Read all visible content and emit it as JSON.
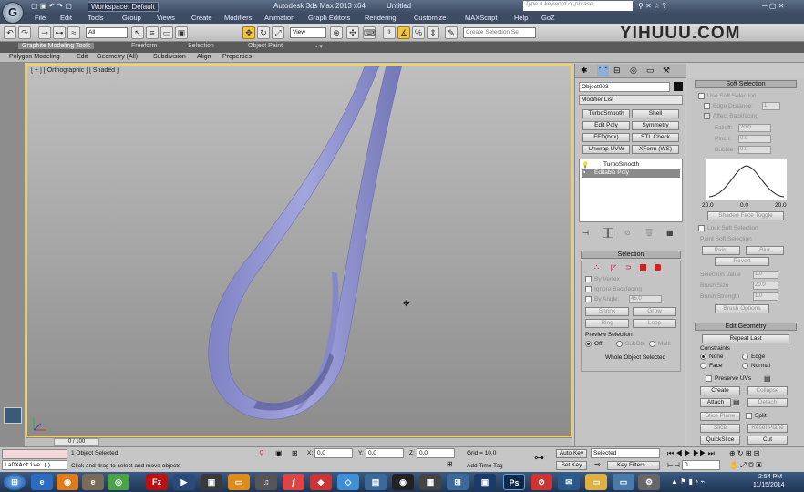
{
  "titlebar": {
    "workspace": "Workspace: Default",
    "title": "Autodesk 3ds Max 2013 x64",
    "doc": "Untitled",
    "search_placeholder": "Type a keyword or phrase"
  },
  "app_logo": "G",
  "menu": [
    "File",
    "Edit",
    "Tools",
    "Group",
    "Views",
    "Create",
    "Modifiers",
    "Animation",
    "Graph Editors",
    "Rendering",
    "Customize",
    "MAXScript",
    "Help",
    "GoZ"
  ],
  "toolbar": {
    "filter_value": "All",
    "refcoord_value": "View",
    "selection_set_placeholder": "Create Selection Se"
  },
  "watermark": "YIHUUU.COM",
  "ribbon": {
    "tabs": [
      "Graphite Modeling Tools",
      "Freeform",
      "Selection",
      "Object Paint"
    ],
    "subtabs": [
      "Polygon Modeling",
      "Edit",
      "Geometry (All)",
      "Subdivision",
      "Align",
      "Properties"
    ]
  },
  "viewport": {
    "label": "[ + ] [ Orthographic ] [ Shaded ]",
    "ribbon_color": "#9b9dd6"
  },
  "modify_panel": {
    "object_name": "Object003",
    "modifier_list": "Modifier List",
    "buttons": [
      "TurboSmooth",
      "Shell",
      "Edit Poly",
      "Symmetry",
      "FFD(box)",
      "STL Check",
      "Unwrap UVW",
      "XForm (WS)"
    ],
    "stack": [
      "TurboSmooth",
      "Editable Poly"
    ],
    "selection": {
      "header": "Selection",
      "by_vertex": "By Vertex",
      "ignore_backfacing": "Ignore Backfacing",
      "by_angle": "By Angle:",
      "angle_value": "45.0",
      "shrink": "Shrink",
      "grow": "Grow",
      "ring": "Ring",
      "loop": "Loop",
      "preview_header": "Preview Selection",
      "preview_off": "Off",
      "preview_subobj": "SubObj",
      "preview_multi": "Multi",
      "status": "Whole Object Selected"
    }
  },
  "soft_selection": {
    "header": "Soft Selection",
    "use_soft": "Use Soft Selection",
    "edge_distance": "Edge Distance:",
    "edge_distance_value": "1",
    "affect_backfacing": "Affect Backfacing",
    "falloff": "Falloff:",
    "falloff_value": "20.0",
    "pinch": "Pinch:",
    "pinch_value": "0.0",
    "bubble": "Bubble:",
    "bubble_value": "0.0",
    "curve_labels": [
      "20.0",
      "0.0",
      "20.0"
    ],
    "shaded_face_toggle": "Shaded Face Toggle",
    "lock_soft": "Lock Soft Selection",
    "paint_header": "Paint Soft Selection",
    "paint": "Paint",
    "blur": "Blur",
    "revert": "Revert",
    "selection_value": "Selection Value",
    "selection_value_num": "1.0",
    "brush_size": "Brush Size",
    "brush_size_num": "20.0",
    "brush_strength": "Brush Strength",
    "brush_strength_num": "1.0",
    "brush_options": "Brush Options"
  },
  "edit_geometry": {
    "header": "Edit Geometry",
    "repeat_last": "Repeat Last",
    "constraints": "Constraints",
    "none": "None",
    "edge": "Edge",
    "face": "Face",
    "normal": "Normal",
    "preserve_uvs": "Preserve UVs",
    "create": "Create",
    "collapse": "Collapse",
    "attach": "Attach",
    "detach": "Detach",
    "slice_plane": "Slice Plane",
    "split": "Split",
    "slice": "Slice",
    "reset_plane": "Reset Plane",
    "quickslice": "QuickSlice",
    "cut": "Cut"
  },
  "timeslider": "0 / 100",
  "status": {
    "selected": "1 Object Selected",
    "prompt": "Click and drag to select and move objects",
    "script_listener": "LaDXActive ()",
    "x_label": "X:",
    "x": "0.0",
    "y_label": "Y:",
    "y": "0.0",
    "z_label": "Z:",
    "z": "0.0",
    "grid": "Grid = 10.0",
    "add_time_tag": "Add Time Tag",
    "auto_key": "Auto Key",
    "set_key": "Set Key",
    "key_mode": "Selected",
    "key_filters": "Key Filters...",
    "frame": "0"
  },
  "taskbar": {
    "time": "2:54 PM",
    "date": "11/15/2014",
    "icons": [
      "start-orb",
      "ie",
      "firefox",
      "filezilla",
      "chrome",
      "media",
      "media-player",
      "photoshop-alt",
      "flash",
      "dropbox",
      "3dsmax",
      "network",
      "vmware",
      "photoshop",
      "security",
      "mail",
      "folder",
      "explorer",
      "gear"
    ]
  }
}
